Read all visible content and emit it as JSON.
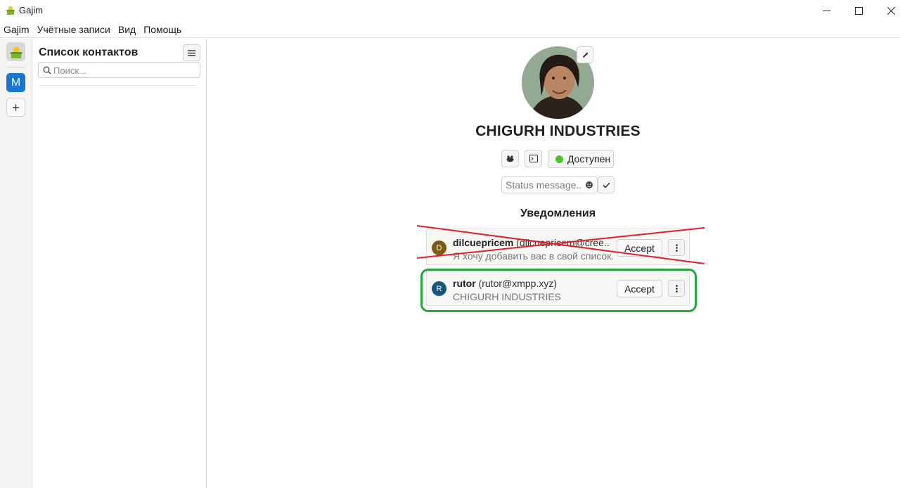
{
  "window": {
    "title": "Gajim"
  },
  "menubar": {
    "items": [
      "Gajim",
      "Учётные записи",
      "Вид",
      "Помощь"
    ]
  },
  "rail": {
    "account_initial": "M",
    "add_label": "+"
  },
  "contacts": {
    "title": "Список контактов",
    "search_placeholder": "Поиск..."
  },
  "account": {
    "name": "CHIGURH INDUSTRIES",
    "status": "Доступен",
    "status_message_placeholder": "Status message..."
  },
  "notifications": {
    "title": "Уведомления",
    "items": [
      {
        "initial": "D",
        "name": "dilcuepricem",
        "jid": "(dilcuepricem@cree...",
        "message": "Я хочу добавить вас в свой список.",
        "accept_label": "Accept",
        "crossed_out": true
      },
      {
        "initial": "R",
        "name": "rutor",
        "jid": "(rutor@xmpp.xyz)",
        "message": "CHIGURH INDUSTRIES",
        "accept_label": "Accept",
        "highlighted": true
      }
    ]
  },
  "colors": {
    "accent_blue": "#1976d2",
    "status_online": "#4fc22c",
    "highlight_green": "#25a73a",
    "cross_red": "#e0202a"
  }
}
